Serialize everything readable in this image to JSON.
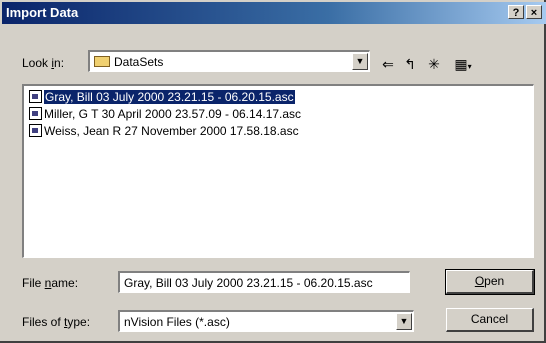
{
  "window": {
    "title": "Import Data",
    "help_label": "?",
    "close_label": "×"
  },
  "look_in": {
    "label_pre": "Look ",
    "label_key": "i",
    "label_post": "n:",
    "value": "DataSets"
  },
  "toolbar": {
    "back_glyph": "⇐",
    "up_glyph": "↰",
    "new_folder_glyph": "✳",
    "view_glyph": "▦"
  },
  "files": [
    {
      "name": "Gray, Bill  03 July 2000 23.21.15 - 06.20.15.asc",
      "selected": true
    },
    {
      "name": "Miller, G T 30 April 2000 23.57.09 - 06.14.17.asc",
      "selected": false
    },
    {
      "name": "Weiss, Jean R 27 November 2000 17.58.18.asc",
      "selected": false
    }
  ],
  "file_name": {
    "label_pre": "File ",
    "label_key": "n",
    "label_post": "ame:",
    "value": "Gray, Bill  03 July 2000 23.21.15 - 06.20.15.asc"
  },
  "file_type": {
    "label_pre": "Files of ",
    "label_key": "t",
    "label_post": "ype:",
    "value": "nVision Files (*.asc)"
  },
  "buttons": {
    "open_key": "O",
    "open_rest": "pen",
    "cancel": "Cancel"
  },
  "colors": {
    "titlebar": "#0a246a",
    "face": "#d4d0c8",
    "selection": "#0a246a"
  }
}
